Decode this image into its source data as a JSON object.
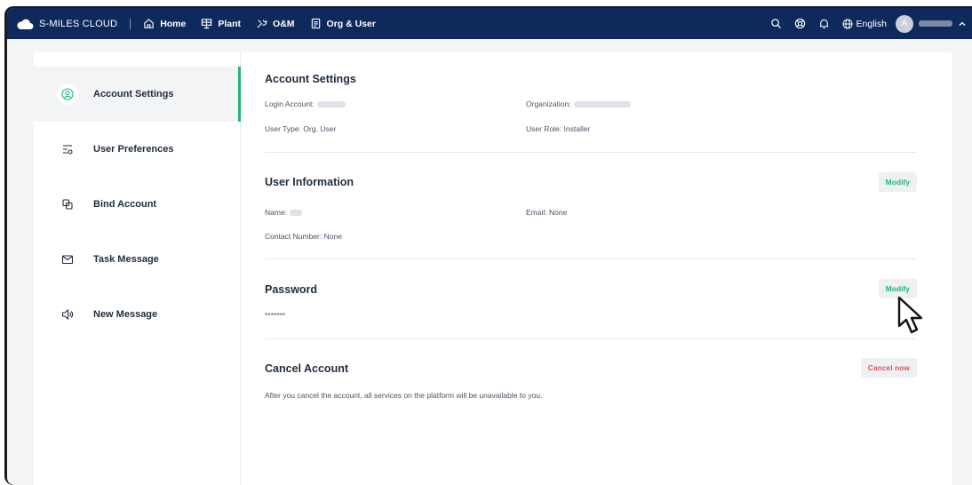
{
  "topbar": {
    "brand": "S-MILES CLOUD",
    "nav": [
      {
        "label": "Home",
        "icon": "home-icon"
      },
      {
        "label": "Plant",
        "icon": "plant-icon"
      },
      {
        "label": "O&M",
        "icon": "tools-icon"
      },
      {
        "label": "Org & User",
        "icon": "document-icon"
      }
    ],
    "language": "English",
    "avatar_initial": "A"
  },
  "sidebar": {
    "items": [
      {
        "label": "Account Settings",
        "icon": "user-circle-icon",
        "active": true
      },
      {
        "label": "User Preferences",
        "icon": "preferences-icon",
        "active": false
      },
      {
        "label": "Bind Account",
        "icon": "bind-icon",
        "active": false
      },
      {
        "label": "Task Message",
        "icon": "mail-icon",
        "active": false
      },
      {
        "label": "New Message",
        "icon": "speaker-icon",
        "active": false
      }
    ]
  },
  "account_settings": {
    "title": "Account Settings",
    "login_account_label": "Login Account:",
    "organization_label": "Organization:",
    "user_type": "User Type: Org. User",
    "user_role": "User Role: Installer"
  },
  "user_information": {
    "title": "User Information",
    "modify_label": "Modify",
    "name_label": "Name:",
    "email": "Email: None",
    "contact_number": "Contact Number: None"
  },
  "password": {
    "title": "Password",
    "modify_label": "Modify",
    "value": "*******"
  },
  "cancel_account": {
    "title": "Cancel Account",
    "button_label": "Cancel now",
    "description": "After you cancel the account, all services on the platform will be unavailable to you."
  },
  "colors": {
    "topbar": "#0e2a5c",
    "accent_green": "#22b573",
    "danger_red": "#e8505b"
  }
}
